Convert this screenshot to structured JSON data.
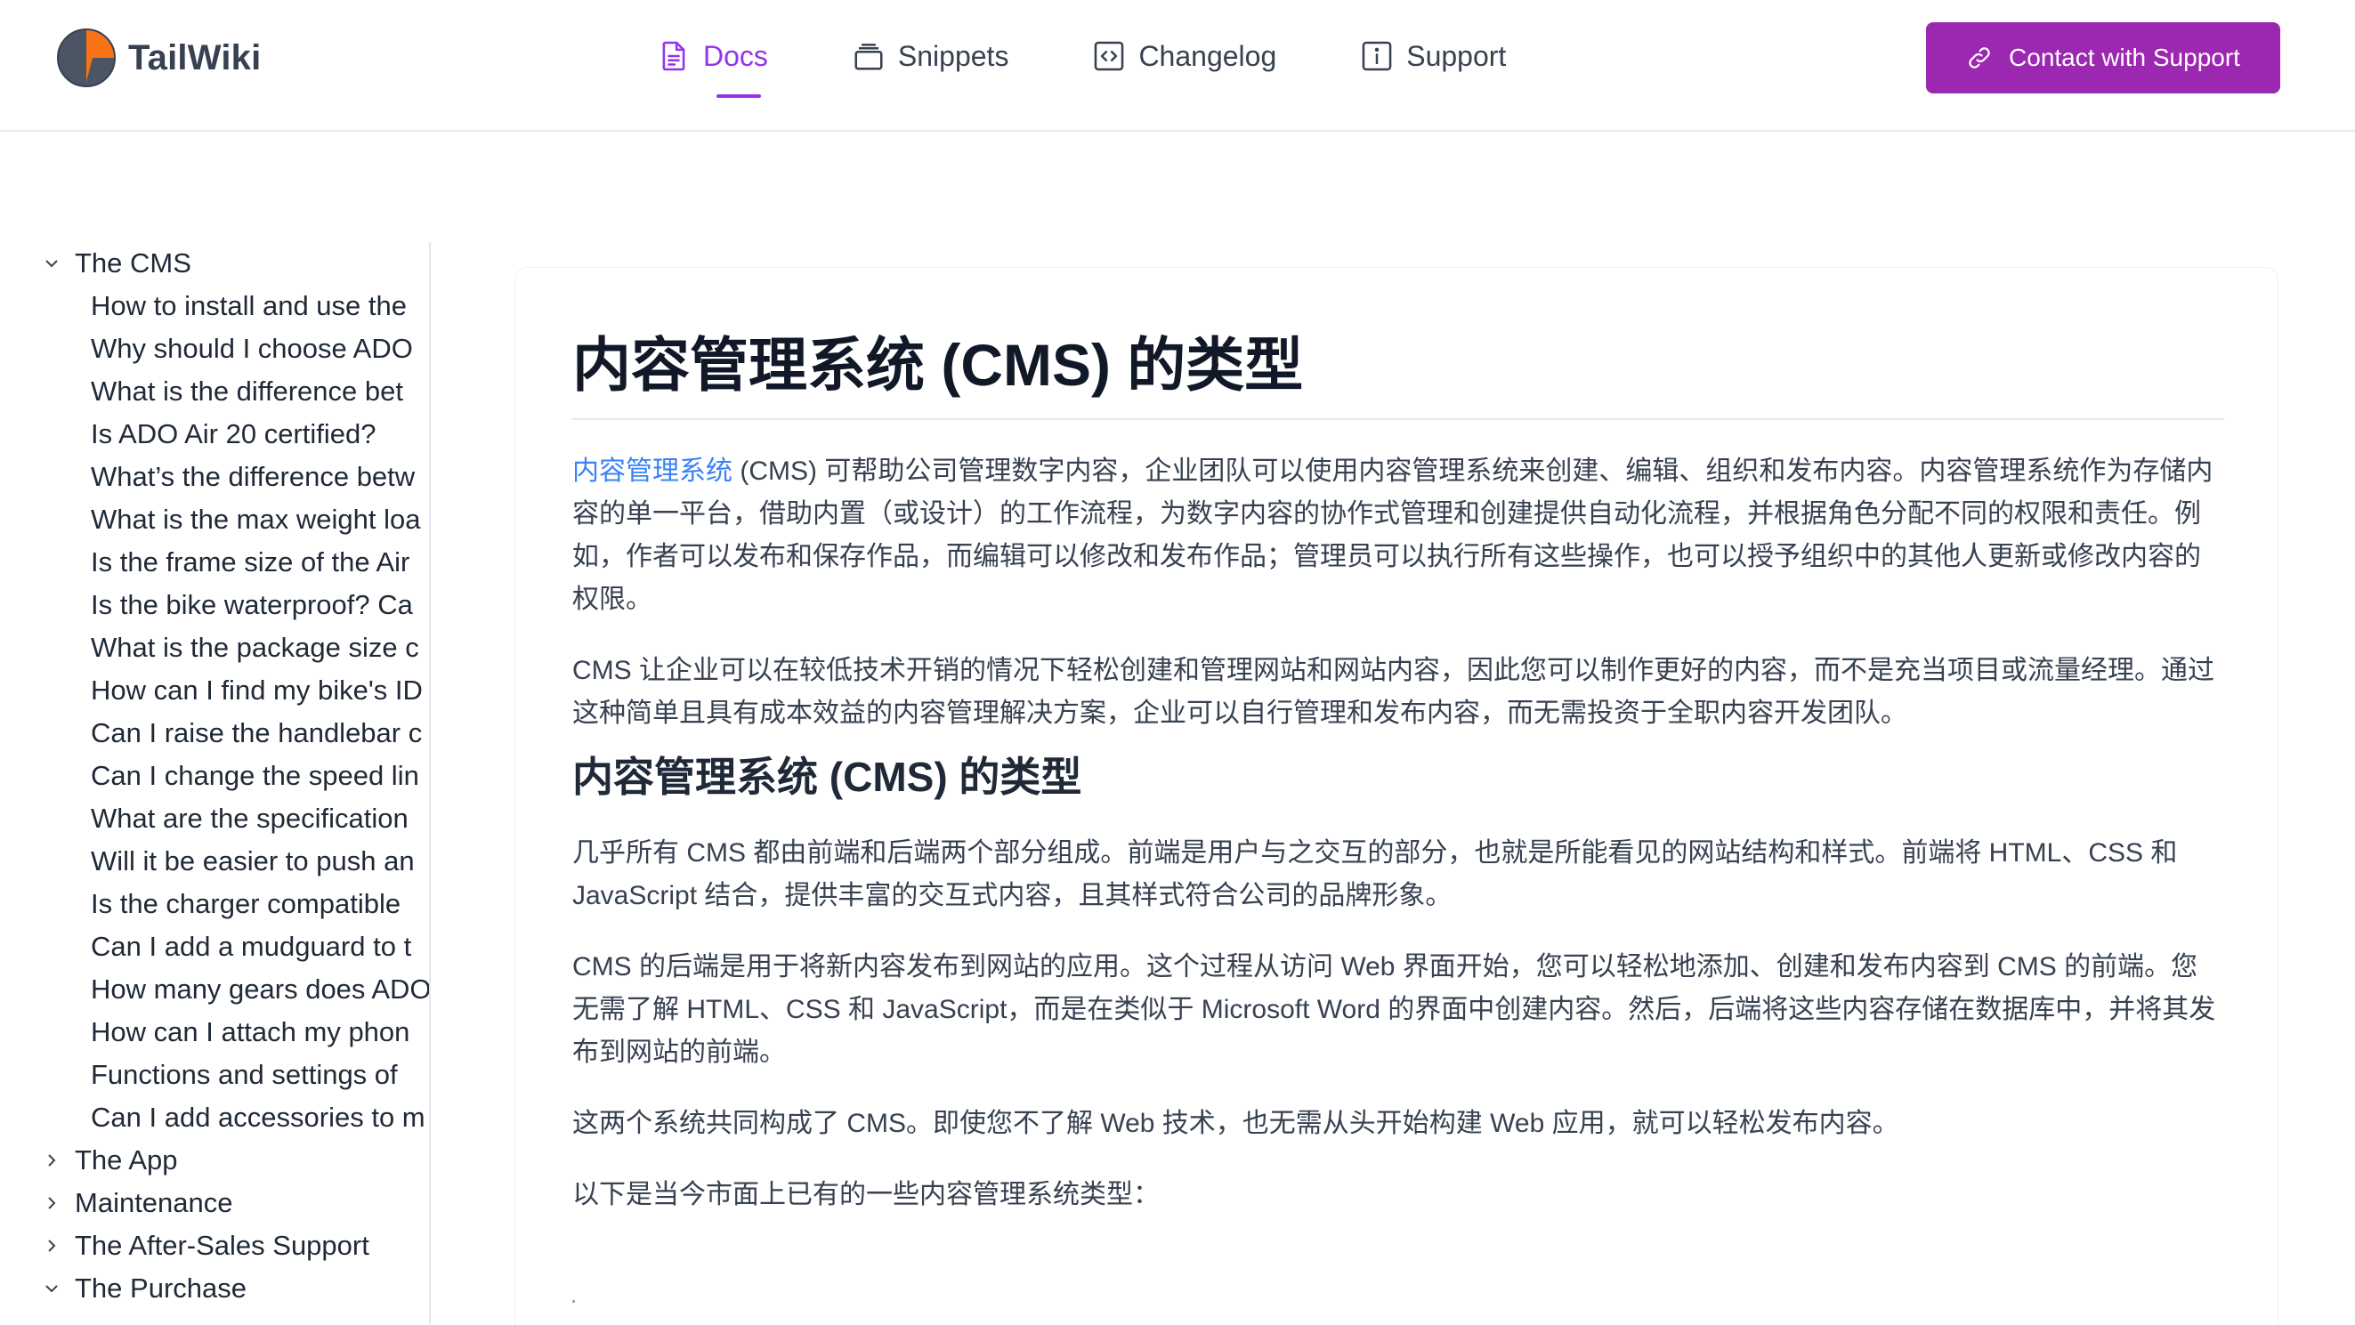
{
  "brand": {
    "name": "TailWiki"
  },
  "nav": [
    {
      "label": "Docs",
      "icon": "doc-icon",
      "active": true
    },
    {
      "label": "Snippets",
      "icon": "stack-icon",
      "active": false
    },
    {
      "label": "Changelog",
      "icon": "code-icon",
      "active": false
    },
    {
      "label": "Support",
      "icon": "info-icon",
      "active": false
    }
  ],
  "cta": {
    "label": "Contact with Support",
    "icon": "link-icon"
  },
  "colors": {
    "accent": "#9333ea",
    "button": "#9c27b0",
    "link": "#3b82f6"
  },
  "sidebar": {
    "sections": [
      {
        "title": "The CMS",
        "expanded": true,
        "items": [
          "How to install and use the",
          "Why should I choose ADO",
          "What is the difference bet",
          "Is ADO Air 20 certified?",
          "What’s the difference betw",
          "What is the max weight loa",
          "Is the frame size of the Air",
          "Is the bike waterproof? Ca",
          "What is the package size c",
          "How can I find my bike's ID",
          "Can I raise the handlebar c",
          "Can I change the speed lin",
          "What are the specification",
          "Will it be easier to push an",
          "Is the charger compatible",
          "Can I add a mudguard to t",
          "How many gears does ADO",
          "How can I attach my phon",
          "Functions and settings of",
          "Can I add accessories to m"
        ]
      },
      {
        "title": "The App",
        "expanded": false
      },
      {
        "title": "Maintenance",
        "expanded": false
      },
      {
        "title": "The After-Sales Support",
        "expanded": false
      },
      {
        "title": "The Purchase",
        "expanded": true
      }
    ]
  },
  "article": {
    "title": "内容管理系统 (CMS) 的类型",
    "p1_link": "内容管理系统",
    "p1_text": " (CMS) 可帮助公司管理数字内容，企业团队可以使用内容管理系统来创建、编辑、组织和发布内容。内容管理系统作为存储内容的单一平台，借助内置（或设计）的工作流程，为数字内容的协作式管理和创建提供自动化流程，并根据角色分配不同的权限和责任。例如，作者可以发布和保存作品，而编辑可以修改和发布作品；管理员可以执行所有这些操作，也可以授予组织中的其他人更新或修改内容的权限。",
    "p2": "CMS 让企业可以在较低技术开销的情况下轻松创建和管理网站和网站内容，因此您可以制作更好的内容，而不是充当项目或流量经理。通过这种简单且具有成本效益的内容管理解决方案，企业可以自行管理和发布内容，而无需投资于全职内容开发团队。",
    "h2": "内容管理系统 (CMS) 的类型",
    "p3": "几乎所有 CMS 都由前端和后端两个部分组成。前端是用户与之交互的部分，也就是所能看见的网站结构和样式。前端将 HTML、CSS 和 JavaScript 结合，提供丰富的交互式内容，且其样式符合公司的品牌形象。",
    "p4": "CMS 的后端是用于将新内容发布到网站的应用。这个过程从访问 Web 界面开始，您可以轻松地添加、创建和发布内容到 CMS 的前端。您无需了解 HTML、CSS 和 JavaScript，而是在类似于 Microsoft Word 的界面中创建内容。然后，后端将这些内容存储在数据库中，并将其发布到网站的前端。",
    "p5": "这两个系统共同构成了 CMS。即使您不了解 Web 技术，也无需从头开始构建 Web 应用，就可以轻松发布内容。",
    "p6": "以下是当今市面上已有的一些内容管理系统类型："
  }
}
